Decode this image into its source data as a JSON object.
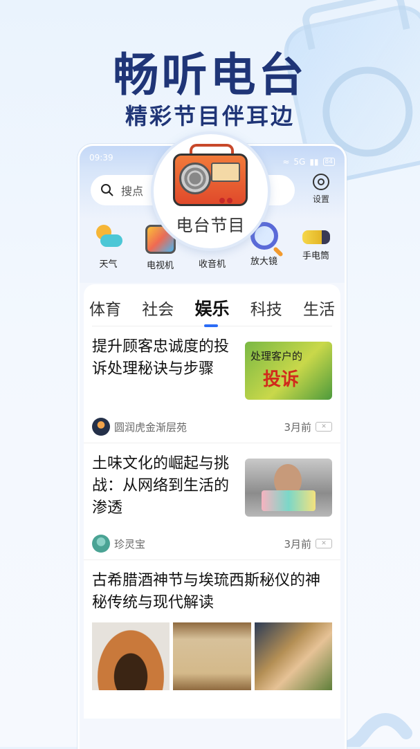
{
  "hero": {
    "title": "畅听电台",
    "subtitle": "精彩节目伴耳边"
  },
  "status_bar": {
    "time": "09:39",
    "signal": "5G",
    "battery": "84"
  },
  "search": {
    "placeholder": "搜点"
  },
  "settings": {
    "label": "设置"
  },
  "popout": {
    "label": "电台节目"
  },
  "tools": [
    {
      "label": "天气",
      "icon": "weather-icon"
    },
    {
      "label": "电视机",
      "icon": "tv-icon"
    },
    {
      "label": "收音机",
      "icon": "radio-icon"
    },
    {
      "label": "放大镜",
      "icon": "magnifier-icon"
    },
    {
      "label": "手电筒",
      "icon": "flashlight-icon"
    }
  ],
  "tabs": [
    {
      "label": "体育"
    },
    {
      "label": "社会"
    },
    {
      "label": "娱乐",
      "active": true
    },
    {
      "label": "科技"
    },
    {
      "label": "生活"
    }
  ],
  "news": [
    {
      "title": "提升顾客忠诚度的投诉处理秘诀与步骤",
      "author": "圆润虎金渐层苑",
      "time": "3月前",
      "thumb_text": "处理客户的",
      "thumb_big": "投诉"
    },
    {
      "title": "土味文化的崛起与挑战：从网络到生活的渗透",
      "author": "珍灵宝",
      "time": "3月前"
    },
    {
      "title": "古希腊酒神节与埃琉西斯秘仪的神秘传统与现代解读"
    }
  ],
  "colors": {
    "hero": "#1f3577",
    "accent": "#2b6cf6"
  }
}
